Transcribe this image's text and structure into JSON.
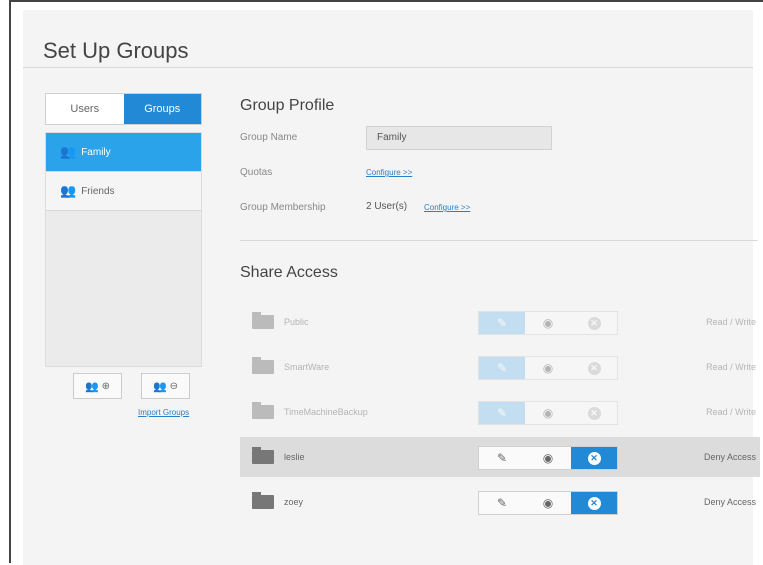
{
  "page": {
    "title": "Set Up Groups"
  },
  "left": {
    "tabs": [
      {
        "label": "Users"
      },
      {
        "label": "Groups"
      }
    ],
    "groups": [
      {
        "label": "Family"
      },
      {
        "label": "Friends"
      }
    ],
    "import_label": "Import Groups"
  },
  "profile": {
    "heading": "Group Profile",
    "name_label": "Group Name",
    "name_value": "Family",
    "quotas_label": "Quotas",
    "quotas_link": "Configure >>",
    "membership_label": "Group Membership",
    "membership_value": "2 User(s)",
    "membership_link": "Configure >>"
  },
  "share": {
    "heading": "Share Access",
    "rows": [
      {
        "name": "Public",
        "permission": "Read / Write"
      },
      {
        "name": "SmartWare",
        "permission": "Read / Write"
      },
      {
        "name": "TimeMachineBackup",
        "permission": "Read / Write"
      },
      {
        "name": "leslie",
        "permission": "Deny Access"
      },
      {
        "name": "zoey",
        "permission": "Deny Access"
      }
    ]
  },
  "colors": {
    "accent": "#2189d6",
    "selected": "#2ba3ea"
  }
}
